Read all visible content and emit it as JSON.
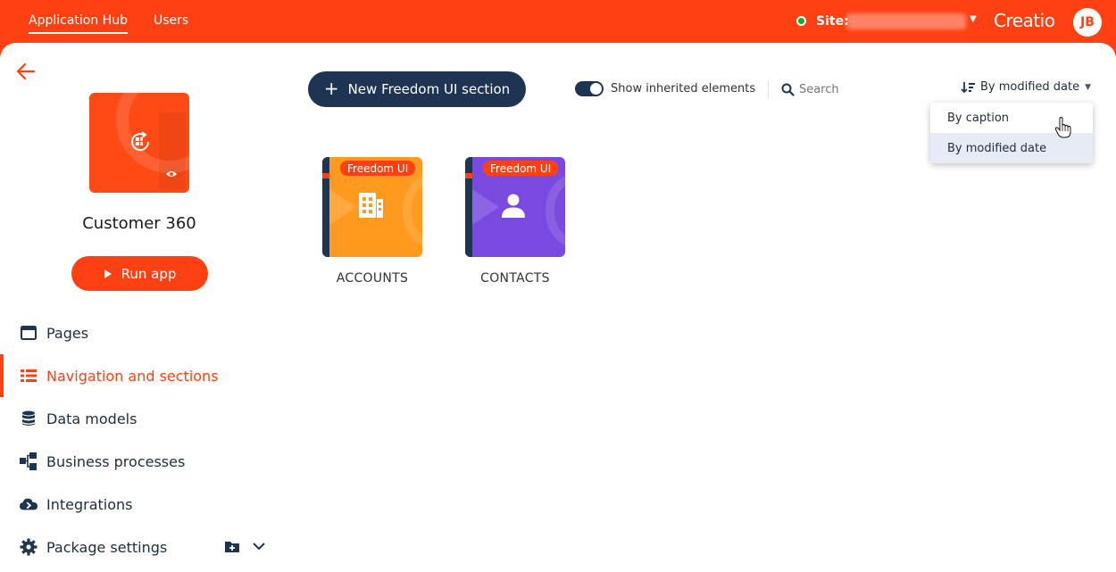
{
  "header": {
    "tabs": [
      {
        "label": "Application Hub",
        "active": true
      },
      {
        "label": "Users",
        "active": false
      }
    ],
    "site_label": "Site:",
    "logo": "Creatio",
    "avatar_initials": "JB"
  },
  "app": {
    "name": "Customer 360",
    "run_label": "Run app"
  },
  "sidebar": {
    "items": [
      {
        "label": "Pages",
        "icon": "window-icon"
      },
      {
        "label": "Navigation and sections",
        "icon": "list-icon",
        "active": true
      },
      {
        "label": "Data models",
        "icon": "database-icon"
      },
      {
        "label": "Business processes",
        "icon": "process-icon"
      },
      {
        "label": "Integrations",
        "icon": "cloud-icon"
      },
      {
        "label": "Package settings",
        "icon": "gear-icon"
      }
    ]
  },
  "toolbar": {
    "new_section_label": "New Freedom UI section",
    "toggle_label": "Show inherited elements",
    "toggle_on": true,
    "search_placeholder": "Search",
    "sort_label": "By modified date"
  },
  "sort_menu": {
    "options": [
      "By caption",
      "By modified date"
    ],
    "selected": "By modified date"
  },
  "sections": [
    {
      "caption": "ACCOUNTS",
      "badge": "Freedom UI",
      "color": "#ff9a1e",
      "icon": "building-icon"
    },
    {
      "caption": "CONTACTS",
      "badge": "Freedom UI",
      "color": "#7a4ae0",
      "icon": "person-icon"
    }
  ],
  "colors": {
    "brand": "#ff4013",
    "navy": "#1d3552",
    "status_online": "#22a82e"
  }
}
